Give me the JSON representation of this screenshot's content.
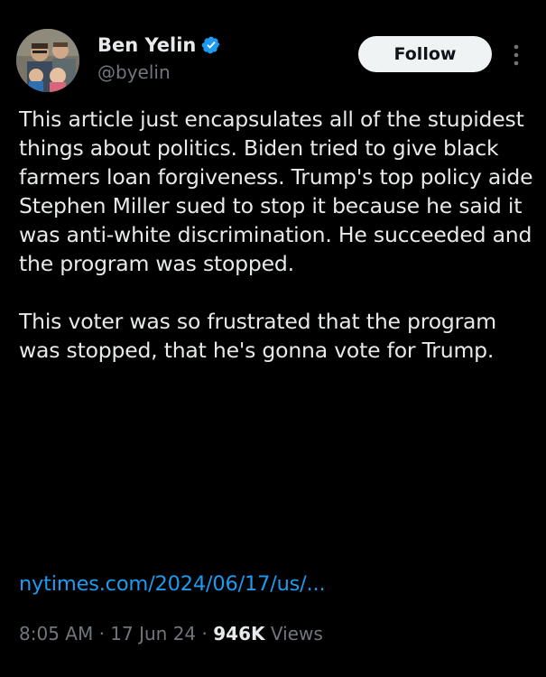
{
  "author": {
    "display_name": "Ben Yelin",
    "handle": "@byelin",
    "verified": true
  },
  "follow_button": {
    "label": "Follow"
  },
  "tweet": {
    "paragraphs": [
      "This article just encapsulates all of the stupidest things about politics. Biden tried to give black farmers loan forgiveness. Trump's top policy aide Stephen Miller sued to stop it because he said it was anti-white discrimination. He succeeded and the program was stopped.",
      "This voter was so frustrated that the program was stopped, that he's gonna vote for Trump."
    ],
    "link_text": "nytimes.com/2024/06/17/us/..."
  },
  "meta": {
    "time": "8:05 AM",
    "separator_1": " · ",
    "date": "17 Jun 24",
    "separator_2": " · ",
    "views_count": "946K",
    "views_label": " Views"
  },
  "colors": {
    "background": "#000000",
    "text_primary": "#e7e9ea",
    "text_secondary": "#71767b",
    "link": "#1d9bf0",
    "verified_badge": "#1d9bf0",
    "follow_button_bg": "#eff3f4"
  },
  "icons": {
    "verified": "verified-badge-icon",
    "more": "more-options-icon"
  }
}
